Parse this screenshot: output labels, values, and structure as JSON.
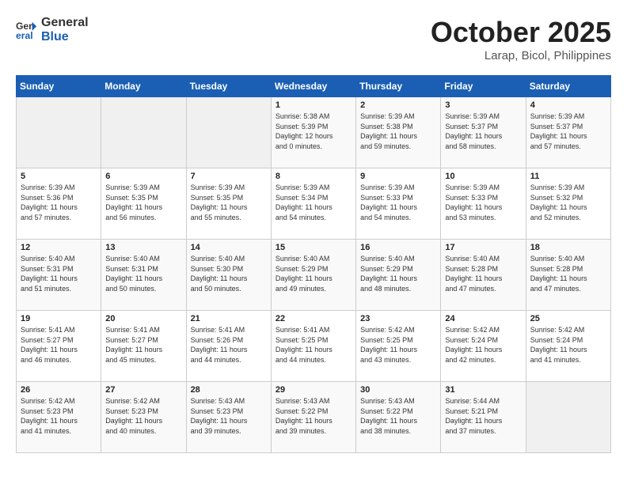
{
  "header": {
    "logo_line1": "General",
    "logo_line2": "Blue",
    "month": "October 2025",
    "location": "Larap, Bicol, Philippines"
  },
  "weekdays": [
    "Sunday",
    "Monday",
    "Tuesday",
    "Wednesday",
    "Thursday",
    "Friday",
    "Saturday"
  ],
  "weeks": [
    [
      {
        "day": "",
        "info": ""
      },
      {
        "day": "",
        "info": ""
      },
      {
        "day": "",
        "info": ""
      },
      {
        "day": "1",
        "info": "Sunrise: 5:38 AM\nSunset: 5:39 PM\nDaylight: 12 hours\nand 0 minutes."
      },
      {
        "day": "2",
        "info": "Sunrise: 5:39 AM\nSunset: 5:38 PM\nDaylight: 11 hours\nand 59 minutes."
      },
      {
        "day": "3",
        "info": "Sunrise: 5:39 AM\nSunset: 5:37 PM\nDaylight: 11 hours\nand 58 minutes."
      },
      {
        "day": "4",
        "info": "Sunrise: 5:39 AM\nSunset: 5:37 PM\nDaylight: 11 hours\nand 57 minutes."
      }
    ],
    [
      {
        "day": "5",
        "info": "Sunrise: 5:39 AM\nSunset: 5:36 PM\nDaylight: 11 hours\nand 57 minutes."
      },
      {
        "day": "6",
        "info": "Sunrise: 5:39 AM\nSunset: 5:35 PM\nDaylight: 11 hours\nand 56 minutes."
      },
      {
        "day": "7",
        "info": "Sunrise: 5:39 AM\nSunset: 5:35 PM\nDaylight: 11 hours\nand 55 minutes."
      },
      {
        "day": "8",
        "info": "Sunrise: 5:39 AM\nSunset: 5:34 PM\nDaylight: 11 hours\nand 54 minutes."
      },
      {
        "day": "9",
        "info": "Sunrise: 5:39 AM\nSunset: 5:33 PM\nDaylight: 11 hours\nand 54 minutes."
      },
      {
        "day": "10",
        "info": "Sunrise: 5:39 AM\nSunset: 5:33 PM\nDaylight: 11 hours\nand 53 minutes."
      },
      {
        "day": "11",
        "info": "Sunrise: 5:39 AM\nSunset: 5:32 PM\nDaylight: 11 hours\nand 52 minutes."
      }
    ],
    [
      {
        "day": "12",
        "info": "Sunrise: 5:40 AM\nSunset: 5:31 PM\nDaylight: 11 hours\nand 51 minutes."
      },
      {
        "day": "13",
        "info": "Sunrise: 5:40 AM\nSunset: 5:31 PM\nDaylight: 11 hours\nand 50 minutes."
      },
      {
        "day": "14",
        "info": "Sunrise: 5:40 AM\nSunset: 5:30 PM\nDaylight: 11 hours\nand 50 minutes."
      },
      {
        "day": "15",
        "info": "Sunrise: 5:40 AM\nSunset: 5:29 PM\nDaylight: 11 hours\nand 49 minutes."
      },
      {
        "day": "16",
        "info": "Sunrise: 5:40 AM\nSunset: 5:29 PM\nDaylight: 11 hours\nand 48 minutes."
      },
      {
        "day": "17",
        "info": "Sunrise: 5:40 AM\nSunset: 5:28 PM\nDaylight: 11 hours\nand 47 minutes."
      },
      {
        "day": "18",
        "info": "Sunrise: 5:40 AM\nSunset: 5:28 PM\nDaylight: 11 hours\nand 47 minutes."
      }
    ],
    [
      {
        "day": "19",
        "info": "Sunrise: 5:41 AM\nSunset: 5:27 PM\nDaylight: 11 hours\nand 46 minutes."
      },
      {
        "day": "20",
        "info": "Sunrise: 5:41 AM\nSunset: 5:27 PM\nDaylight: 11 hours\nand 45 minutes."
      },
      {
        "day": "21",
        "info": "Sunrise: 5:41 AM\nSunset: 5:26 PM\nDaylight: 11 hours\nand 44 minutes."
      },
      {
        "day": "22",
        "info": "Sunrise: 5:41 AM\nSunset: 5:25 PM\nDaylight: 11 hours\nand 44 minutes."
      },
      {
        "day": "23",
        "info": "Sunrise: 5:42 AM\nSunset: 5:25 PM\nDaylight: 11 hours\nand 43 minutes."
      },
      {
        "day": "24",
        "info": "Sunrise: 5:42 AM\nSunset: 5:24 PM\nDaylight: 11 hours\nand 42 minutes."
      },
      {
        "day": "25",
        "info": "Sunrise: 5:42 AM\nSunset: 5:24 PM\nDaylight: 11 hours\nand 41 minutes."
      }
    ],
    [
      {
        "day": "26",
        "info": "Sunrise: 5:42 AM\nSunset: 5:23 PM\nDaylight: 11 hours\nand 41 minutes."
      },
      {
        "day": "27",
        "info": "Sunrise: 5:42 AM\nSunset: 5:23 PM\nDaylight: 11 hours\nand 40 minutes."
      },
      {
        "day": "28",
        "info": "Sunrise: 5:43 AM\nSunset: 5:23 PM\nDaylight: 11 hours\nand 39 minutes."
      },
      {
        "day": "29",
        "info": "Sunrise: 5:43 AM\nSunset: 5:22 PM\nDaylight: 11 hours\nand 39 minutes."
      },
      {
        "day": "30",
        "info": "Sunrise: 5:43 AM\nSunset: 5:22 PM\nDaylight: 11 hours\nand 38 minutes."
      },
      {
        "day": "31",
        "info": "Sunrise: 5:44 AM\nSunset: 5:21 PM\nDaylight: 11 hours\nand 37 minutes."
      },
      {
        "day": "",
        "info": ""
      }
    ]
  ]
}
